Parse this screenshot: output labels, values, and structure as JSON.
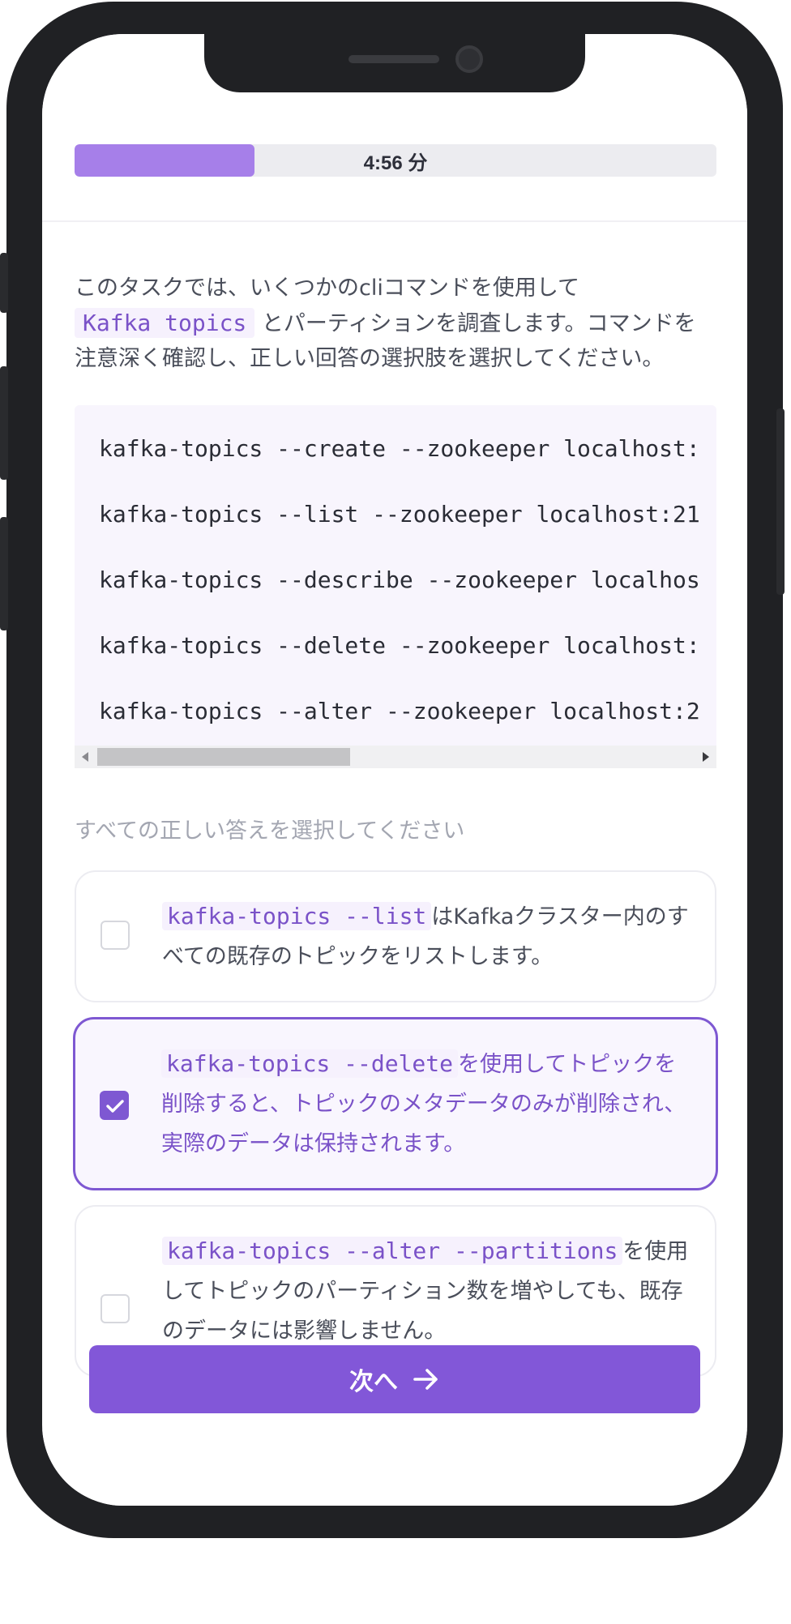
{
  "progress": {
    "label": "4:56 分",
    "fraction": 0.28
  },
  "intro": {
    "before": "このタスクでは、いくつかのcliコマンドを使用して",
    "code": "Kafka topics",
    "after": "とパーティションを調査します。コマンドを注意深く確認し、正しい回答の選択肢を選択してください。"
  },
  "code_block": {
    "lines": [
      "kafka-topics --create --zookeeper localhost:",
      "kafka-topics --list --zookeeper localhost:21",
      "kafka-topics --describe --zookeeper localhos",
      "kafka-topics --delete --zookeeper localhost:",
      "kafka-topics --alter --zookeeper localhost:2"
    ]
  },
  "instruction": "すべての正しい答えを選択してください",
  "options": [
    {
      "code": "kafka-topics --list",
      "text": "はKafkaクラスター内のすべての既存のトピックをリストします。",
      "checked": false
    },
    {
      "code": "kafka-topics --delete",
      "text": "を使用してトピックを削除すると、トピックのメタデータのみが削除され、実際のデータは保持されます。",
      "checked": true
    },
    {
      "code": "kafka-topics --alter --partitions",
      "text": "を使用してトピックのパーティション数を増やしても、既存のデータには影響しません。",
      "checked": false
    }
  ],
  "next_button": {
    "label": "次へ"
  },
  "colors": {
    "accent": "#8257d8",
    "progress": "#a67fe9",
    "selected_border": "#7e58d2"
  }
}
